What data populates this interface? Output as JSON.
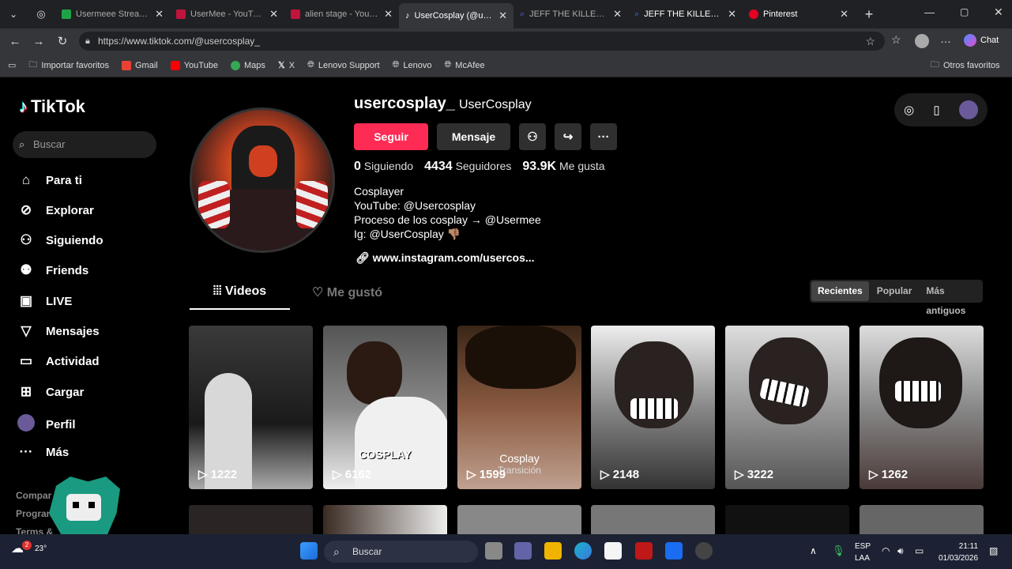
{
  "browser": {
    "tabs": [
      {
        "title": "Usermeee Stream - \\",
        "color": "#1ea446"
      },
      {
        "title": "UserMee - YouTube",
        "color": "#c0143c"
      },
      {
        "title": "alien stage - YouTub",
        "color": "#c0143c"
      },
      {
        "title": "UserCosplay (@userc",
        "color": "#ffffff",
        "active": true
      },
      {
        "title": "JEFF THE KILLER - Bu",
        "color": "#4a6cf7"
      },
      {
        "title": "JEFF THE KILLER - Bo",
        "color": "#4a6cf7"
      },
      {
        "title": "Pinterest",
        "color": "#e60023"
      }
    ],
    "url": "https://www.tiktok.com/@usercosplay_",
    "bookmarks": [
      "Importar favoritos",
      "Gmail",
      "YouTube",
      "Maps",
      "X",
      "Lenovo Support",
      "Lenovo",
      "McAfee"
    ],
    "other_favorites": "Otros favoritos",
    "chat": "Chat"
  },
  "sidebar": {
    "logo": "TikTok",
    "search_placeholder": "Buscar",
    "items": [
      {
        "label": "Para ti",
        "icon": "home-icon"
      },
      {
        "label": "Explorar",
        "icon": "compass-icon"
      },
      {
        "label": "Siguiendo",
        "icon": "following-icon"
      },
      {
        "label": "Friends",
        "icon": "friends-icon"
      },
      {
        "label": "LIVE",
        "icon": "live-icon"
      },
      {
        "label": "Mensajes",
        "icon": "send-icon"
      },
      {
        "label": "Actividad",
        "icon": "activity-icon"
      },
      {
        "label": "Cargar",
        "icon": "upload-icon"
      },
      {
        "label": "Perfil",
        "icon": "profile-avatar-icon"
      },
      {
        "label": "Más",
        "icon": "more-icon"
      }
    ],
    "footer": [
      "Compar",
      "Progran",
      "Terms &"
    ]
  },
  "profile": {
    "username": "usercosplay_",
    "nickname": "UserCosplay",
    "follow_label": "Seguir",
    "message_label": "Mensaje",
    "following_count": "0",
    "following_label": "Siguiendo",
    "followers_count": "4434",
    "followers_label": "Seguidores",
    "likes_count": "93.9K",
    "likes_label": "Me gusta",
    "bio": [
      "Cosplayer",
      "YouTube: @Usercosplay",
      "Proceso de los cosplay → @Usermee",
      "Ig: @UserCosplay 👎🏽"
    ],
    "link": "www.instagram.com/usercos..."
  },
  "content_tabs": {
    "videos": "Videos",
    "liked": "Me gustó"
  },
  "sort": [
    "Recientes",
    "Popular",
    "Más antiguos"
  ],
  "videos": [
    {
      "views": "1222",
      "caption": ""
    },
    {
      "views": "6162",
      "caption": "COSPLAY"
    },
    {
      "views": "1599",
      "caption": "Cosplay"
    },
    {
      "views": "2148",
      "caption": ""
    },
    {
      "views": "3222",
      "caption": ""
    },
    {
      "views": "1262",
      "caption": ""
    }
  ],
  "videos_caption2": "Transición",
  "taskbar": {
    "search": "Buscar",
    "weather": "23°",
    "weather_badge": "2",
    "lang_top": "ESP",
    "lang_bottom": "LAA",
    "time": "21:11",
    "date": "01/03/2026"
  }
}
